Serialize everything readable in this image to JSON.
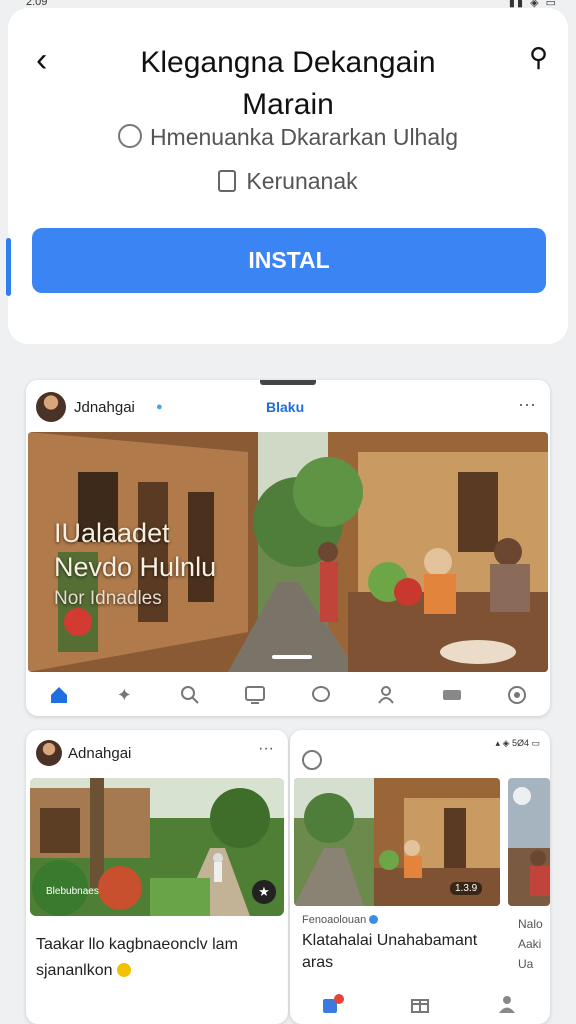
{
  "status": {
    "time": "2:09",
    "icons": "▮▮ ◈ ▭"
  },
  "header": {
    "back_label": "‹",
    "title": "Klegangna Dekangain Marain",
    "share_label": "⚲",
    "developer": "Hmenuanka Dkararkan Ulhalg",
    "category": "Kerunanak"
  },
  "install_label": "INSTAL",
  "screenshot1": {
    "username": "Jdnahgai",
    "verified": "●",
    "tagline": "Blaku",
    "more_label": "···",
    "overlay_line1": "IUalaadet",
    "overlay_line2": "Nevdo Hulnlu",
    "overlay_line3": "Nor Idnadles",
    "nav_icons": [
      "home-icon",
      "explore-icon",
      "search-icon",
      "tv-icon",
      "chat-icon",
      "profile-icon",
      "video-icon",
      "settings-icon"
    ]
  },
  "screenshot2": {
    "username": "Adnahgai",
    "more_label": "···",
    "photo_caption": "Blebubnaes",
    "bookmark_label": "★",
    "caption": "Taakar llo kagbnaeonclv lam sjananlkon"
  },
  "screenshot3": {
    "status_text": "▴ ◈ 5Ø4 ▭",
    "badge": "1.3.9",
    "subtitle": "Fenoaolouan",
    "caption": "Klatahalai Unahabamant aras",
    "side_caption": "Nalo Aaki Ua"
  },
  "colors": {
    "accent": "#3a84f4",
    "nav_active": "#1f6fe0",
    "background": "#eef0f2"
  }
}
